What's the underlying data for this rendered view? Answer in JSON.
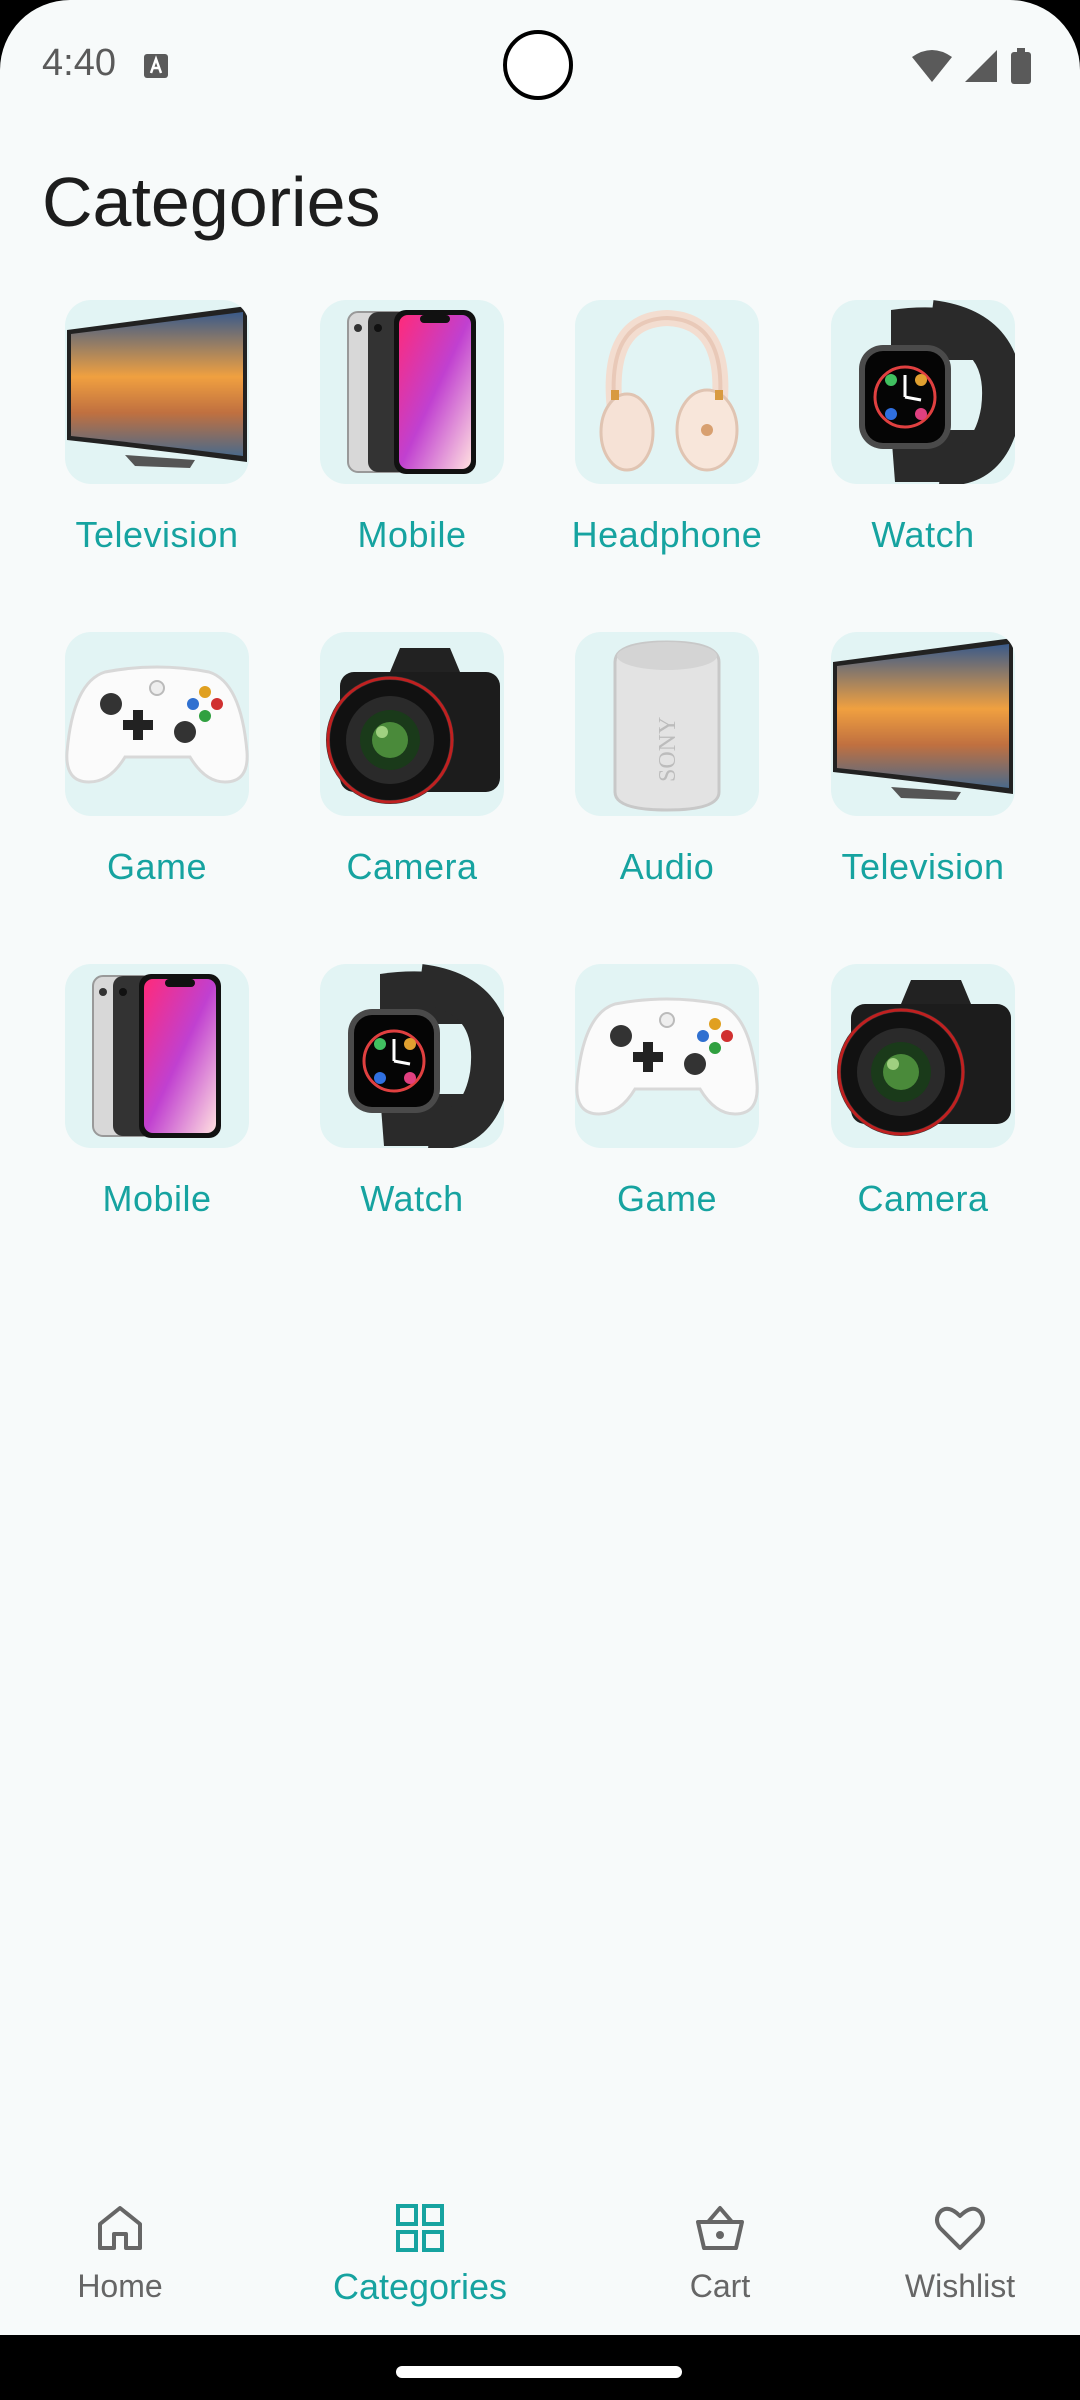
{
  "status_bar": {
    "time": "4:40"
  },
  "header": {
    "title": "Categories"
  },
  "categories": [
    {
      "label": "Television",
      "icon": "television-icon"
    },
    {
      "label": "Mobile",
      "icon": "mobile-icon"
    },
    {
      "label": "Headphone",
      "icon": "headphone-icon"
    },
    {
      "label": "Watch",
      "icon": "watch-icon"
    },
    {
      "label": "Game",
      "icon": "game-controller-icon"
    },
    {
      "label": "Camera",
      "icon": "camera-icon"
    },
    {
      "label": "Audio",
      "icon": "speaker-icon"
    },
    {
      "label": "Television",
      "icon": "television-icon"
    },
    {
      "label": "Mobile",
      "icon": "mobile-icon"
    },
    {
      "label": "Watch",
      "icon": "watch-icon"
    },
    {
      "label": "Game",
      "icon": "game-controller-icon"
    },
    {
      "label": "Camera",
      "icon": "camera-icon"
    }
  ],
  "bottom_nav": {
    "items": [
      {
        "label": "Home",
        "icon": "home-icon",
        "active": false
      },
      {
        "label": "Categories",
        "icon": "grid-icon",
        "active": true
      },
      {
        "label": "Cart",
        "icon": "basket-icon",
        "active": false
      },
      {
        "label": "Wishlist",
        "icon": "heart-icon",
        "active": false
      }
    ]
  },
  "colors": {
    "accent": "#16a3a0",
    "tile_background": "#e2f4f4",
    "page_background": "#f7fafa",
    "title_text": "#1d1d1d",
    "nav_inactive": "#666666"
  }
}
